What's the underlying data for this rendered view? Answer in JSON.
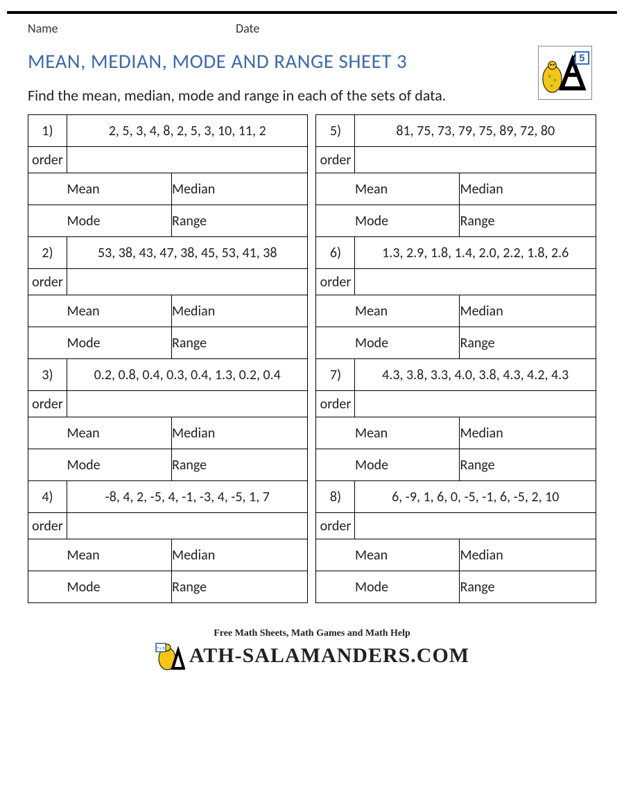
{
  "header": {
    "name_label": "Name",
    "date_label": "Date",
    "grade_badge": "5"
  },
  "title": "MEAN, MEDIAN, MODE AND RANGE SHEET 3",
  "instructions": "Find the mean, median, mode and range in each of the sets of data.",
  "labels": {
    "order": "order",
    "mean": "Mean",
    "median": "Median",
    "mode": "Mode",
    "range": "Range"
  },
  "problems_left": [
    {
      "n": "1)",
      "data": "2, 5, 3, 4, 8, 2, 5, 3, 10, 11, 2"
    },
    {
      "n": "2)",
      "data": "53, 38, 43, 47, 38, 45, 53, 41, 38"
    },
    {
      "n": "3)",
      "data": "0.2, 0.8, 0.4, 0.3, 0.4, 1.3, 0.2, 0.4"
    },
    {
      "n": "4)",
      "data": "-8, 4, 2, -5, 4, -1, -3, 4, -5, 1, 7"
    }
  ],
  "problems_right": [
    {
      "n": "5)",
      "data": "81, 75, 73, 79, 75, 89, 72, 80"
    },
    {
      "n": "6)",
      "data": "1.3, 2.9, 1.8, 1.4, 2.0, 2.2, 1.8, 2.6"
    },
    {
      "n": "7)",
      "data": "4.3, 3.8, 3.3, 4.0, 3.8, 4.3, 4.2, 4.3"
    },
    {
      "n": "8)",
      "data": "6, -9, 1, 6, 0, -5, -1, 6, -5, 2, 10"
    }
  ],
  "footer": {
    "tagline": "Free Math Sheets, Math Games and Math Help",
    "brand": "ATH-SALAMANDERS.COM"
  }
}
